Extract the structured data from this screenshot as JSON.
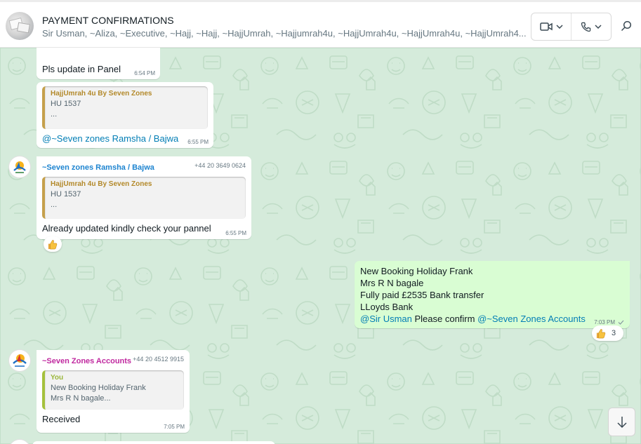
{
  "chat_header": {
    "title": "PAYMENT CONFIRMATIONS",
    "members": "Sir Usman, ~Aliza, ~Executive, ~Hajj, ~Hajj, ~HajjUmrah, ~Hajjumrah4u, ~HajjUmrah4u, ~HajjUmrah4u, ~HajjUmrah4..."
  },
  "messages": [
    {
      "text": "Pls update in Panel",
      "time": "6:54 PM"
    },
    {
      "quote": {
        "author": "HajjUmrah 4u By Seven Zones",
        "text": "HU 1537\n..."
      },
      "mention": "@~Seven zones Ramsha / Bajwa",
      "time": "6:55 PM"
    },
    {
      "sender": "~Seven zones Ramsha / Bajwa",
      "phone": "+44 20 3649 0624",
      "quote": {
        "author": "HajjUmrah 4u By Seven Zones",
        "text": "HU 1537\n..."
      },
      "text": "Already updated kindly check your pannel",
      "time": "6:55 PM",
      "reaction": {
        "emoji": "thumbs-up"
      }
    },
    {
      "text": "New Booking Holiday Frank\nMrs R N bagale\nFully paid £2535 Bank transfer\nLLoyds Bank",
      "mention_1": "@Sir Usman",
      "mid_text": " Please confirm ",
      "mention_2": "@~Seven Zones Accounts",
      "time": "7:03 PM",
      "reaction": {
        "emoji": "thumbs-up",
        "count": "3"
      }
    },
    {
      "sender": "~Seven Zones Accounts",
      "phone": "+44 20 4512 9915",
      "quote": {
        "author": "You",
        "text": "New Booking Holiday Frank\nMrs R N bagale..."
      },
      "text": "Received",
      "time": "7:05 PM"
    }
  ],
  "colors": {
    "chat_background": "#d5ebdb",
    "outgoing_bubble": "#d9fdd3",
    "mention": "#027eb5",
    "sender_ramsha": "#1d84d0",
    "sender_accounts": "#c0289f"
  }
}
